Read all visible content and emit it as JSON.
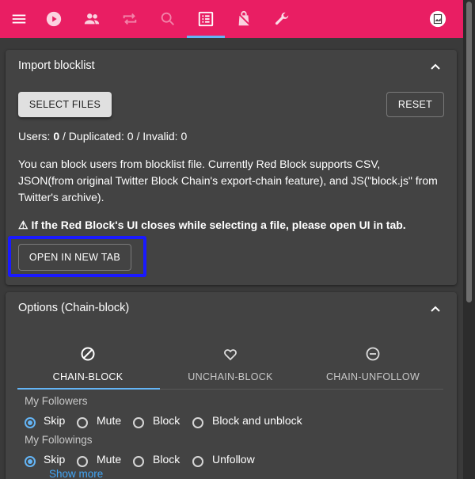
{
  "nav": {
    "icons": [
      "menu-icon",
      "play-icon",
      "people-icon",
      "repeat-icon",
      "search-icon",
      "list-icon",
      "shopping-bag-icon",
      "wrench-icon",
      "avatar"
    ]
  },
  "import_panel": {
    "title": "Import blocklist",
    "select_files": "SELECT FILES",
    "reset": "RESET",
    "stats_users_label": "Users:",
    "stats_users_value": "0",
    "stats_dup_label": "/ Duplicated:",
    "stats_dup_value": "0",
    "stats_invalid_label": "/ Invalid:",
    "stats_invalid_value": "0",
    "description": "You can block users from blocklist file. Currently Red Block supports CSV, JSON(from original Twitter Block Chain's export-chain feature), and JS(\"block.js\" from Twitter's archive).",
    "warning": "⚠ If the Red Block's UI closes while selecting a file, please open UI in tab.",
    "open_new_tab": "OPEN IN NEW TAB"
  },
  "options_panel": {
    "title": "Options (Chain-block)",
    "tabs": [
      {
        "label": "CHAIN-BLOCK",
        "icon": "block-icon",
        "active": true
      },
      {
        "label": "UNCHAIN-BLOCK",
        "icon": "heart-icon",
        "active": false
      },
      {
        "label": "CHAIN-UNFOLLOW",
        "icon": "minus-circle-icon",
        "active": false
      }
    ],
    "followers": {
      "label": "My Followers",
      "options": [
        "Skip",
        "Mute",
        "Block",
        "Block and unblock"
      ],
      "selected": "Skip"
    },
    "followings": {
      "label": "My Followings",
      "options": [
        "Skip",
        "Mute",
        "Block",
        "Unfollow"
      ],
      "selected": "Skip"
    },
    "show_more": "Show more"
  },
  "colors": {
    "accent": "#e91e63",
    "primary": "#64b5f6",
    "highlight": "#1a1aff"
  }
}
